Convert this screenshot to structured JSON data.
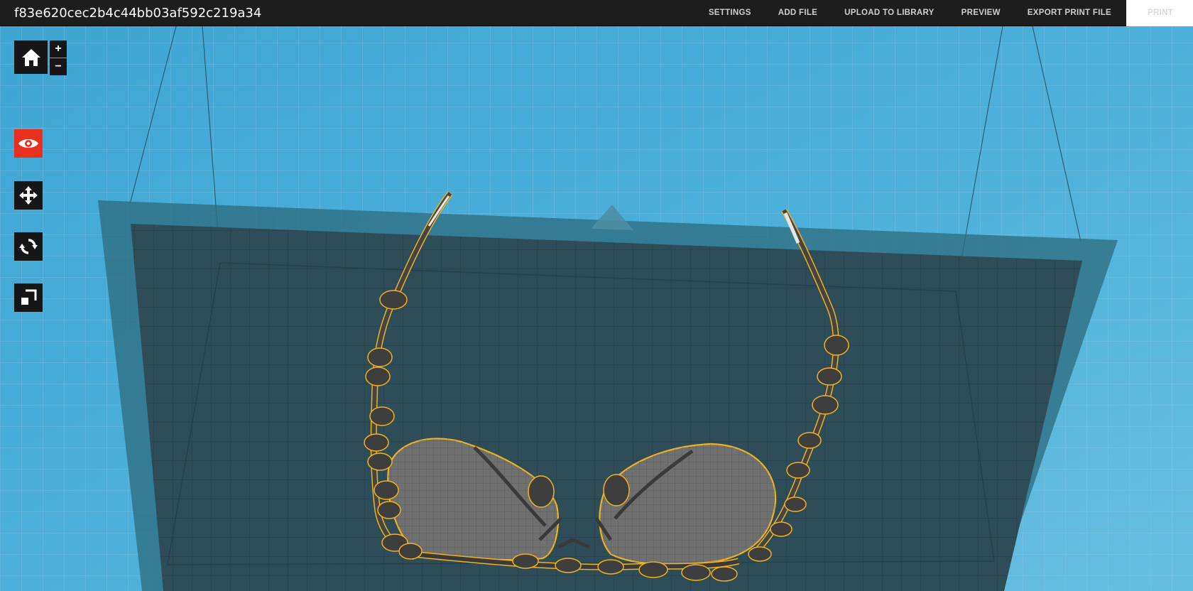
{
  "app": {
    "title": "f83e620cec2b4c44bb03af592c219a34"
  },
  "nav": {
    "items": [
      {
        "label": "SETTINGS"
      },
      {
        "label": "ADD FILE"
      },
      {
        "label": "UPLOAD TO LIBRARY"
      },
      {
        "label": "PREVIEW"
      },
      {
        "label": "EXPORT PRINT FILE"
      }
    ],
    "print_label": "PRINT"
  },
  "toolbar": {
    "zoom_in_label": "+",
    "zoom_out_label": "−",
    "tools": [
      {
        "name": "home",
        "icon": "home-icon"
      },
      {
        "name": "view",
        "icon": "eye-icon",
        "active": true
      },
      {
        "name": "move",
        "icon": "move-arrows-icon"
      },
      {
        "name": "rotate",
        "icon": "rotate-icon"
      },
      {
        "name": "scale",
        "icon": "scale-icon"
      }
    ]
  },
  "colors": {
    "topbar": "#1d1d1d",
    "active_tool": "#e8301e",
    "background": "#4fb0d8",
    "selection_outline": "#f2b21c"
  }
}
